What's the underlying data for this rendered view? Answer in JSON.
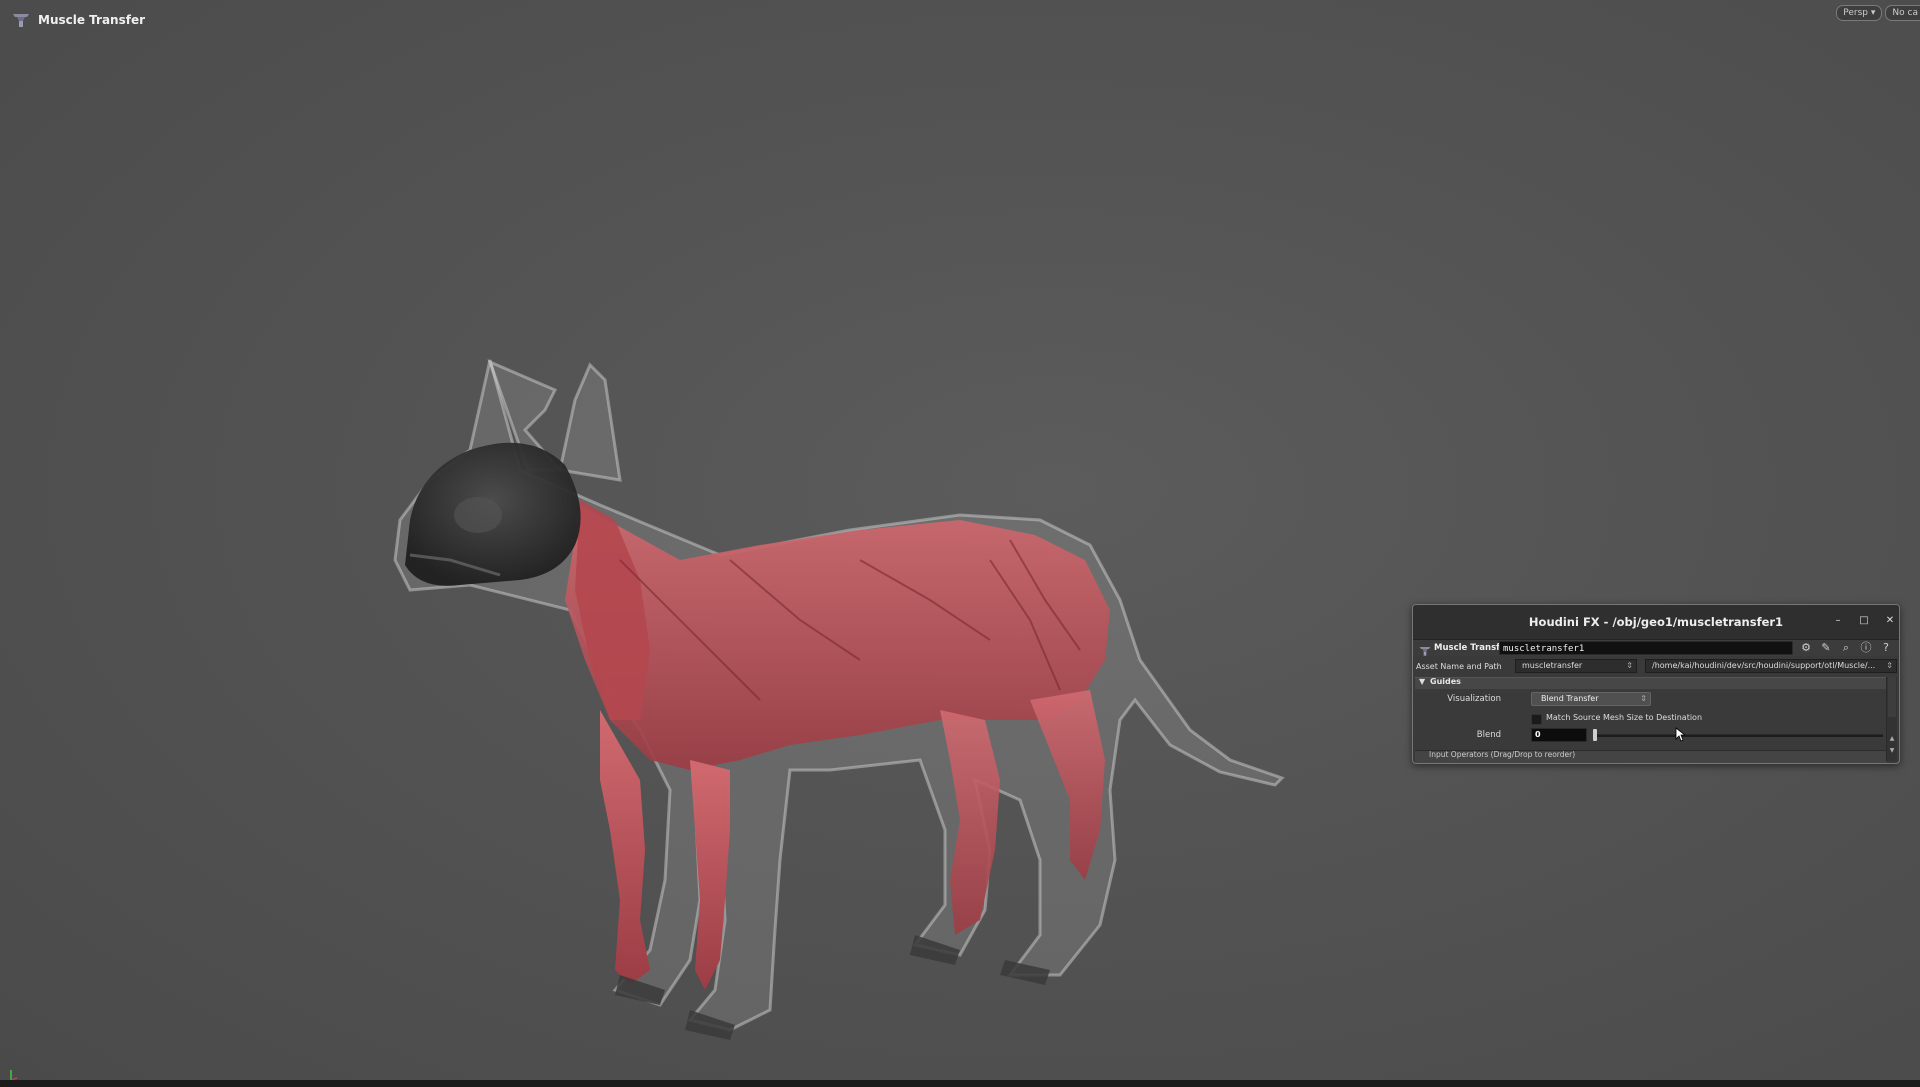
{
  "viewport": {
    "title": "Muscle Transfer",
    "camera_menu": "Persp",
    "camera_menu_arrow": "▾",
    "cam_menu": "No ca",
    "background_color": "#555555"
  },
  "param_window": {
    "title": "Houdini FX - /obj/geo1/muscletransfer1",
    "minimize": "–",
    "maximize": "□",
    "close": "✕",
    "node_type": "Muscle Transfer",
    "node_name": "muscletransfer1",
    "toolbar_icons": [
      "gear-icon",
      "brush-icon",
      "zoom-icon",
      "info-icon",
      "help-icon"
    ],
    "toolbar_glyphs": {
      "gear": "⚙",
      "brush": "✎",
      "zoom": "⌕",
      "info": "ⓘ",
      "help": "?"
    },
    "asset_label": "Asset Name and Path",
    "asset_name": "muscletransfer",
    "asset_path": "/home/kai/houdini/dev/src/houdini/support/otl/Muscle/...",
    "spinner": "⇕",
    "folder": {
      "label": "Guides",
      "expanded": true,
      "arrow": "▼"
    },
    "visualization": {
      "label": "Visualization",
      "value": "Blend Transfer"
    },
    "match_size": {
      "label": "Match Source Mesh Size to Destination",
      "checked": false
    },
    "blend": {
      "label": "Blend",
      "value": "0",
      "fraction": 0.0
    },
    "input_operators": "Input Operators (Drag/Drop to reorder)",
    "scroll_up": "▲",
    "scroll_down": "▼"
  },
  "colors": {
    "muscle": "#c2545a",
    "skin": "#bdbdbd",
    "bone": "#2a2a2a",
    "accent": "#ffffff"
  }
}
